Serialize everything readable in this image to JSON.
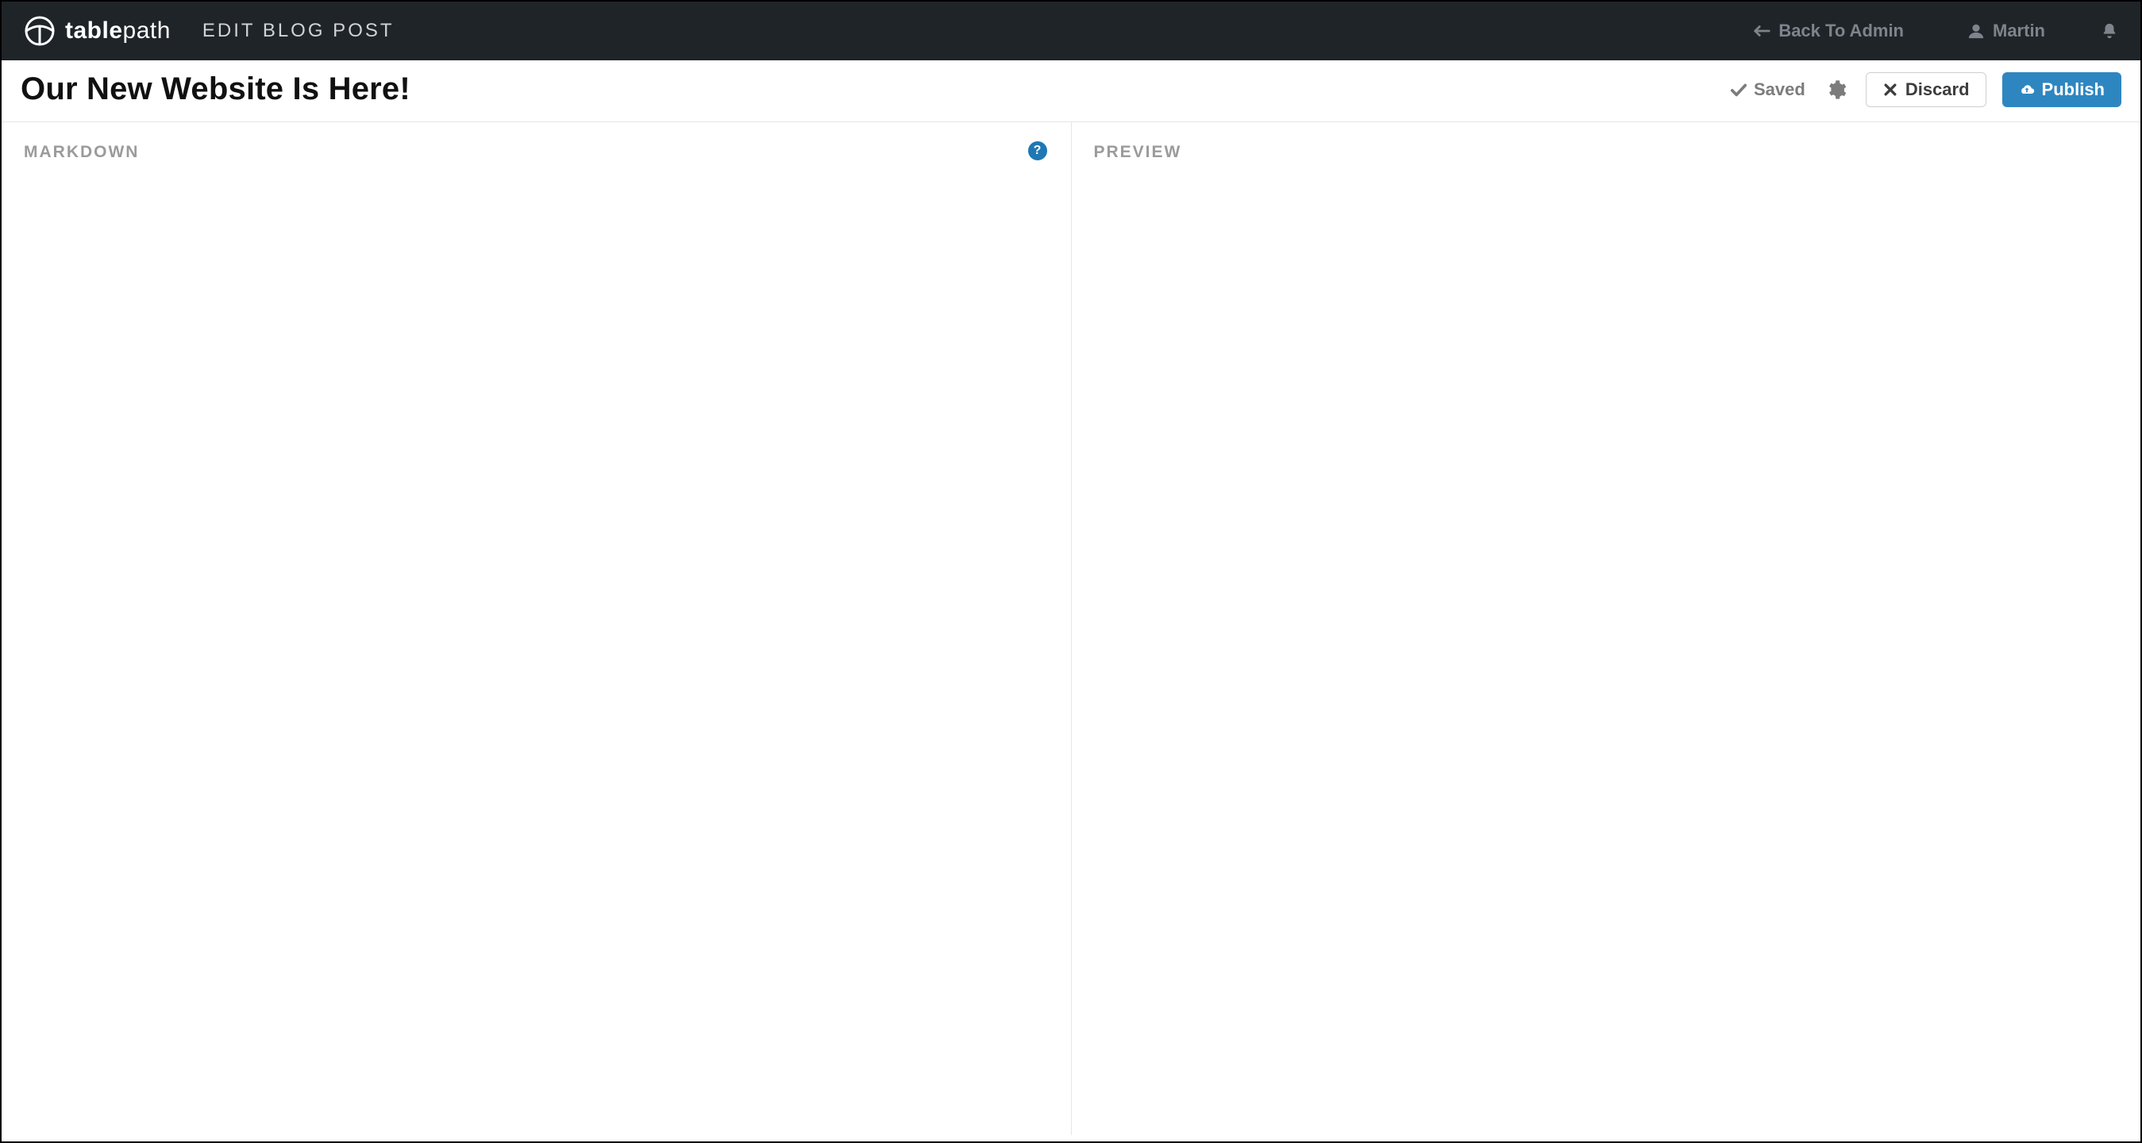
{
  "brand": {
    "name_bold": "table",
    "name_light": "path"
  },
  "header": {
    "context": "EDIT BLOG POST",
    "back_link": "Back To Admin",
    "user_name": "Martin"
  },
  "post": {
    "title": "Our New Website Is Here!"
  },
  "toolbar": {
    "status_label": "Saved",
    "discard_label": "Discard",
    "publish_label": "Publish"
  },
  "panes": {
    "markdown_label": "MARKDOWN",
    "preview_label": "PREVIEW",
    "help_glyph": "?"
  }
}
